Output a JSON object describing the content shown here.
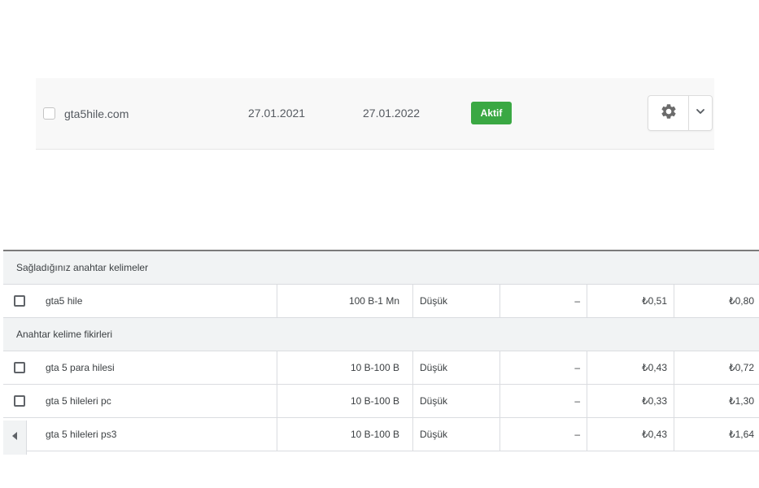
{
  "domain": {
    "name": "gta5hile.com",
    "start_date": "27.01.2021",
    "end_date": "27.01.2022",
    "status": "Aktif",
    "status_color": "#3aa843"
  },
  "actions": {
    "settings_icon": "gear-icon",
    "expand_icon": "chevron-down-icon"
  },
  "keywords": {
    "provided_header": "Sağladığınız anahtar kelimeler",
    "provided_rows": [
      {
        "keyword": "gta5 hile",
        "volume": "100 B-1 Mn",
        "competition": "Düşük",
        "share": "–",
        "bid_low": "₺0,51",
        "bid_high": "₺0,80"
      }
    ],
    "ideas_header": "Anahtar kelime fikirleri",
    "idea_rows": [
      {
        "keyword": "gta 5 para hilesi",
        "volume": "10 B-100 B",
        "competition": "Düşük",
        "share": "–",
        "bid_low": "₺0,43",
        "bid_high": "₺0,72"
      },
      {
        "keyword": "gta 5 hileleri pc",
        "volume": "10 B-100 B",
        "competition": "Düşük",
        "share": "–",
        "bid_low": "₺0,33",
        "bid_high": "₺1,30"
      },
      {
        "keyword": "gta 5 hileleri ps3",
        "volume": "10 B-100 B",
        "competition": "Düşük",
        "share": "–",
        "bid_low": "₺0,43",
        "bid_high": "₺1,64"
      }
    ],
    "scroll_icon": "arrow-left-icon"
  }
}
